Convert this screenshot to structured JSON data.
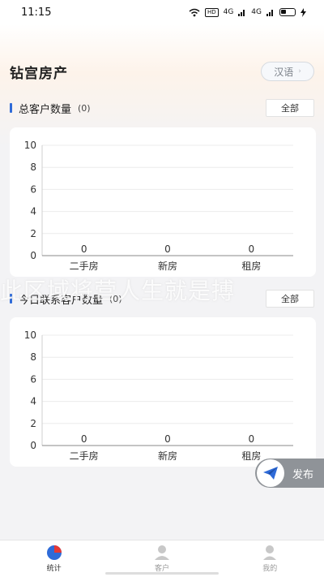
{
  "status_bar": {
    "time": "11:15",
    "badge": "HD",
    "net1": "4G",
    "net2": "4G"
  },
  "header": {
    "title": "钻宫房产",
    "lang_label": "汉语"
  },
  "sections": [
    {
      "title": "总客户数量",
      "count": "(0)",
      "filter_label": "全部"
    },
    {
      "title": "今日联系客户数量",
      "count": "(0)",
      "filter_label": "全部"
    }
  ],
  "watermark": "此区域将营人生就是搏",
  "fab": {
    "label": "发布"
  },
  "tabs": [
    {
      "label": "统计",
      "icon": "pie-chart-icon",
      "active": true
    },
    {
      "label": "客户",
      "icon": "person-icon",
      "active": false
    },
    {
      "label": "我的",
      "icon": "user-icon",
      "active": false
    }
  ],
  "colors": {
    "accent": "#2f6bd8",
    "pie_red": "#e53935",
    "pie_blue": "#2f6bd8"
  },
  "chart_data": [
    {
      "type": "bar",
      "title": "总客户数量",
      "categories": [
        "二手房",
        "新房",
        "租房"
      ],
      "values": [
        0,
        0,
        0
      ],
      "yticks": [
        0,
        2,
        4,
        6,
        8,
        10
      ],
      "ylim": [
        0,
        10
      ],
      "grid": true
    },
    {
      "type": "bar",
      "title": "今日联系客户数量",
      "categories": [
        "二手房",
        "新房",
        "租房"
      ],
      "values": [
        0,
        0,
        0
      ],
      "yticks": [
        0,
        2,
        4,
        6,
        8,
        10
      ],
      "ylim": [
        0,
        10
      ],
      "grid": true
    }
  ]
}
